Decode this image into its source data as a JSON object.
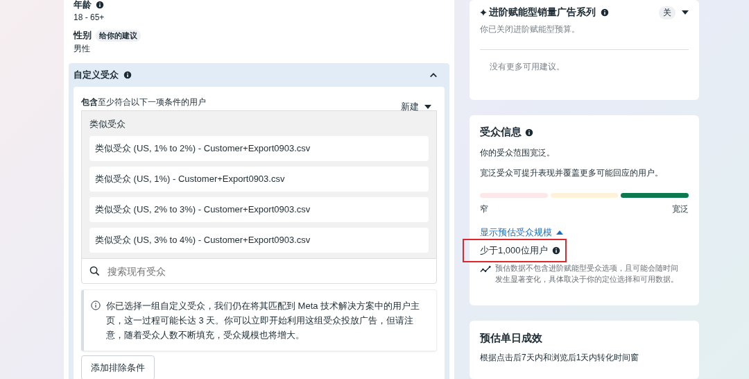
{
  "demographics": [
    {
      "label": "年龄",
      "info": true,
      "value": "18 - 65+"
    },
    {
      "label": "性别",
      "info": false,
      "badge": "给你的建议",
      "value": "男性"
    }
  ],
  "custom_audience": {
    "title": "自定义受众",
    "expanded": true,
    "include_text": "**包含**至少符合以下一项条件的用户",
    "new_button": "新建",
    "group_title": "类似受众",
    "audiences": [
      "类似受众 (US, 1% to 2%) - Customer+Export0903.csv",
      "类似受众 (US, 1%) - Customer+Export0903.csv",
      "类似受众 (US, 2% to 3%) - Customer+Export0903.csv",
      "类似受众 (US, 3% to 4%) - Customer+Export0903.csv"
    ],
    "search": {
      "placeholder": "搜索现有受众"
    },
    "notice": "你已选择一组自定义受众，我们仍在将其匹配到 Meta 技术解决方案中的用户主页，这一过程可能长达 3 天。你可以立即开始利用这组受众投放广告，但请注意，随着受众人数不断填充，受众规模也将增大。",
    "exclude_button": "添加排除条件"
  },
  "advantage_campaign": {
    "title": "进阶赋能型销量广告系列",
    "toggle": "关",
    "subtitle": "你已关闭进阶赋能型预算。",
    "empty": "没有更多可用建议。"
  },
  "audience_info": {
    "title": "受众信息",
    "line1": "你的受众范围宽泛。",
    "line2": "宽泛受众可提升表现并覆盖更多可能回应的用户。",
    "segments": [
      {
        "color": "#fde8e9"
      },
      {
        "color": "#fdf2da"
      },
      {
        "color": "#0b7a50"
      }
    ],
    "low_label": "窄",
    "high_label": "宽泛",
    "size_link": "显示预估受众规模",
    "size_expanded": true,
    "size": "少于1,000位用户",
    "highlighted": true,
    "note": "预估数据不包含进阶赋能型受众选项，且可能会随时间发生显著变化，具体取决于你的定位选择和可用数据。"
  },
  "daily_results": {
    "title": "预估单日成效",
    "subtitle": "根据点击后7天内和浏览后1天内转化时间窗"
  }
}
